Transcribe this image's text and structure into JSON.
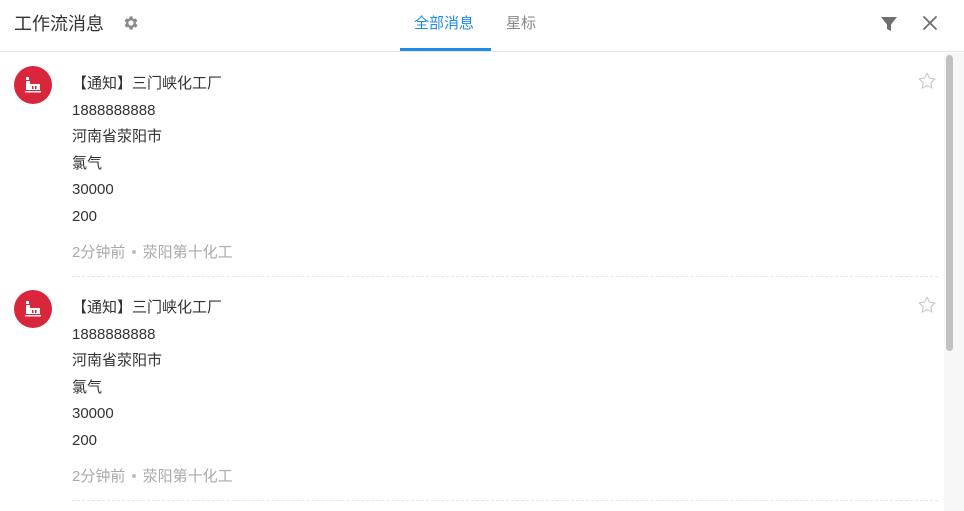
{
  "header": {
    "title": "工作流消息",
    "tabs": [
      {
        "label": "全部消息",
        "active": true
      },
      {
        "label": "星标",
        "active": false
      }
    ],
    "accent_color": "#1f8ceb"
  },
  "messages": [
    {
      "title": "【通知】三门峡化工厂",
      "lines": [
        "1888888888",
        "河南省荥阳市",
        "氯气",
        "30000",
        "200"
      ],
      "time": "2分钟前",
      "source": "荥阳第十化工",
      "avatar_icon": "factory-icon",
      "avatar_color": "#d9263b",
      "starred": false
    },
    {
      "title": "【通知】三门峡化工厂",
      "lines": [
        "1888888888",
        "河南省荥阳市",
        "氯气",
        "30000",
        "200"
      ],
      "time": "2分钟前",
      "source": "荥阳第十化工",
      "avatar_icon": "factory-icon",
      "avatar_color": "#d9263b",
      "starred": false
    }
  ]
}
